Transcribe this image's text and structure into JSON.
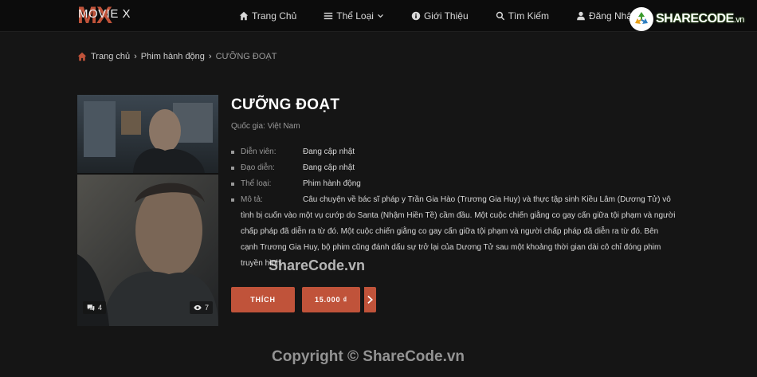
{
  "header": {
    "logo_mark": "MX",
    "logo_text": "MOVIE X",
    "nav": [
      {
        "label": "Trang Chủ",
        "icon": "home-icon"
      },
      {
        "label": "Thể Loại",
        "icon": "list-icon"
      },
      {
        "label": "Giới Thiệu",
        "icon": "info-icon"
      },
      {
        "label": "Tìm Kiếm",
        "icon": "search-icon"
      },
      {
        "label": "Đăng Nhập",
        "icon": "user-icon"
      }
    ],
    "brand_badge": {
      "name": "SHARECODE",
      "tld": ".vn"
    }
  },
  "breadcrumb": {
    "home": "Trang chủ",
    "category": "Phim hành động",
    "current": "CƯỠNG ĐOẠT"
  },
  "poster": {
    "comments": "4",
    "views": "7"
  },
  "movie": {
    "title": "CƯỠNG ĐOẠT",
    "country_label": "Quốc gia:",
    "country": "Việt Nam",
    "actors_label": "Diễn viên:",
    "actors": "Đang cập nhật",
    "director_label": "Đạo diễn:",
    "director": "Đang cập nhật",
    "genre_label": "Thể loại:",
    "genre": "Phim hành động",
    "description_label": "Mô tả:",
    "description": "Câu chuyện về bác sĩ pháp y Trần Gia Hào (Trương Gia Huy) và thực tập sinh Kiều Lâm (Dương Tử) vô tình bị cuốn vào một vụ cướp do Santa (Nhậm Hiền Tề) cầm đầu. Một cuộc chiến giằng co gay cấn giữa tội phạm và người chấp pháp đã diễn ra từ đó. Một cuộc chiến giằng co gay cấn giữa tội phạm và người chấp pháp đã diễn ra từ đó. Bên cạnh Trương Gia Huy, bộ phim cũng đánh dấu sự trở lại của Dương Tử sau một khoảng thời gian dài cô chỉ đóng phim truyền hình."
  },
  "actions": {
    "like_label": "THÍCH",
    "price_label": "15.000 ₫"
  },
  "watermarks": {
    "middle": "ShareCode.vn",
    "bottom": "Copyright © ShareCode.vn"
  },
  "colors": {
    "accent": "#c0533a",
    "background": "#151515",
    "header": "#0c0c0c"
  }
}
